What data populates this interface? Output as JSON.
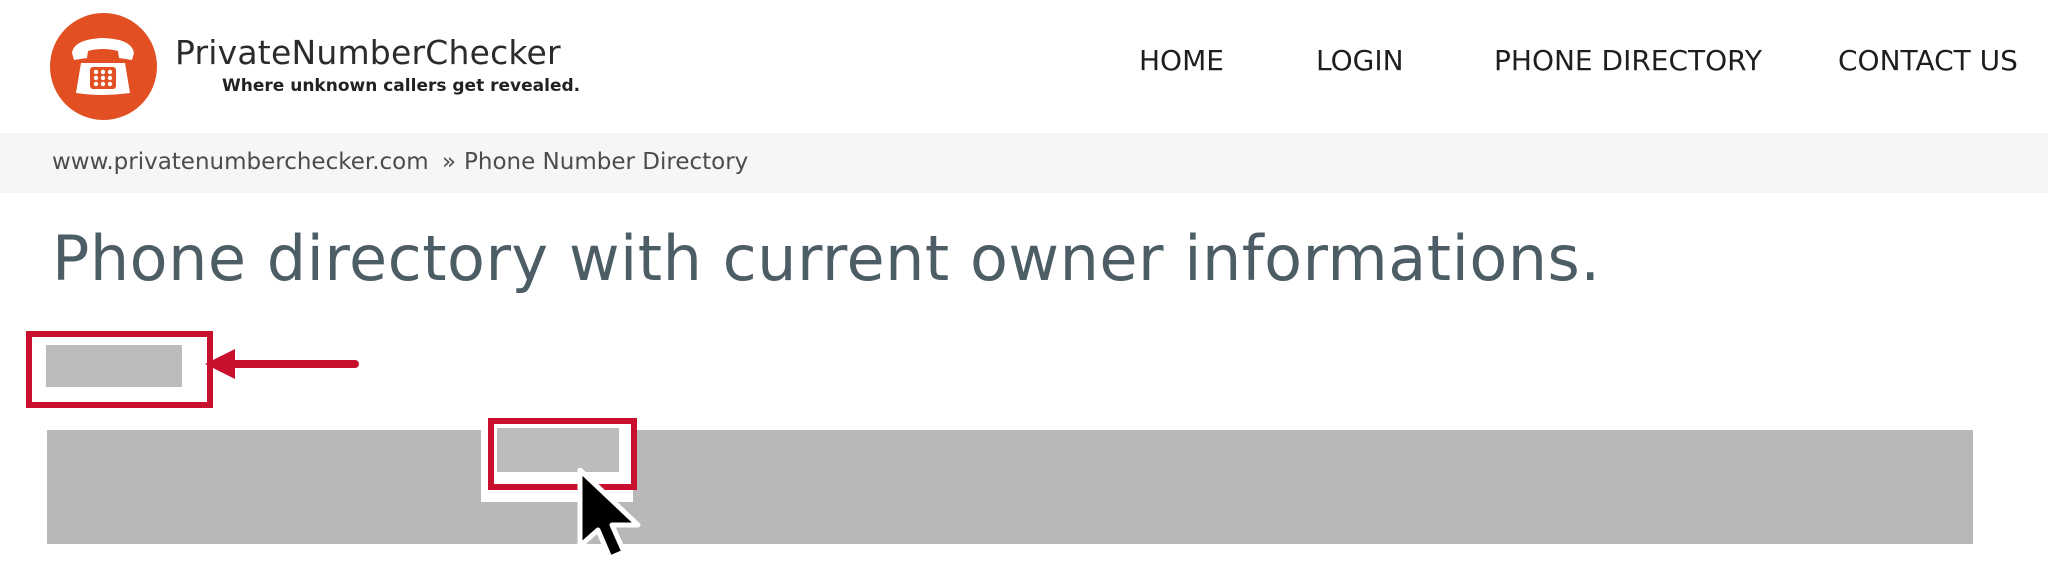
{
  "brand": {
    "name": "PrivateNumberChecker",
    "tagline": "Where unknown callers get revealed.",
    "logo_icon": "telephone-icon",
    "logo_color": "#e14f22"
  },
  "nav": {
    "items": [
      {
        "label": "HOME"
      },
      {
        "label": "LOGIN"
      },
      {
        "label": "PHONE DIRECTORY"
      },
      {
        "label": "CONTACT US"
      }
    ]
  },
  "breadcrumb": {
    "home": "www.privatenumberchecker.com",
    "separator": "»",
    "current": "Phone Number Directory"
  },
  "main": {
    "title": "Phone directory with current owner informations."
  },
  "annotations": {
    "highlight_color": "#c8102e",
    "cursor_icon": "mouse-pointer-icon",
    "arrow_icon": "arrow-left-icon"
  }
}
